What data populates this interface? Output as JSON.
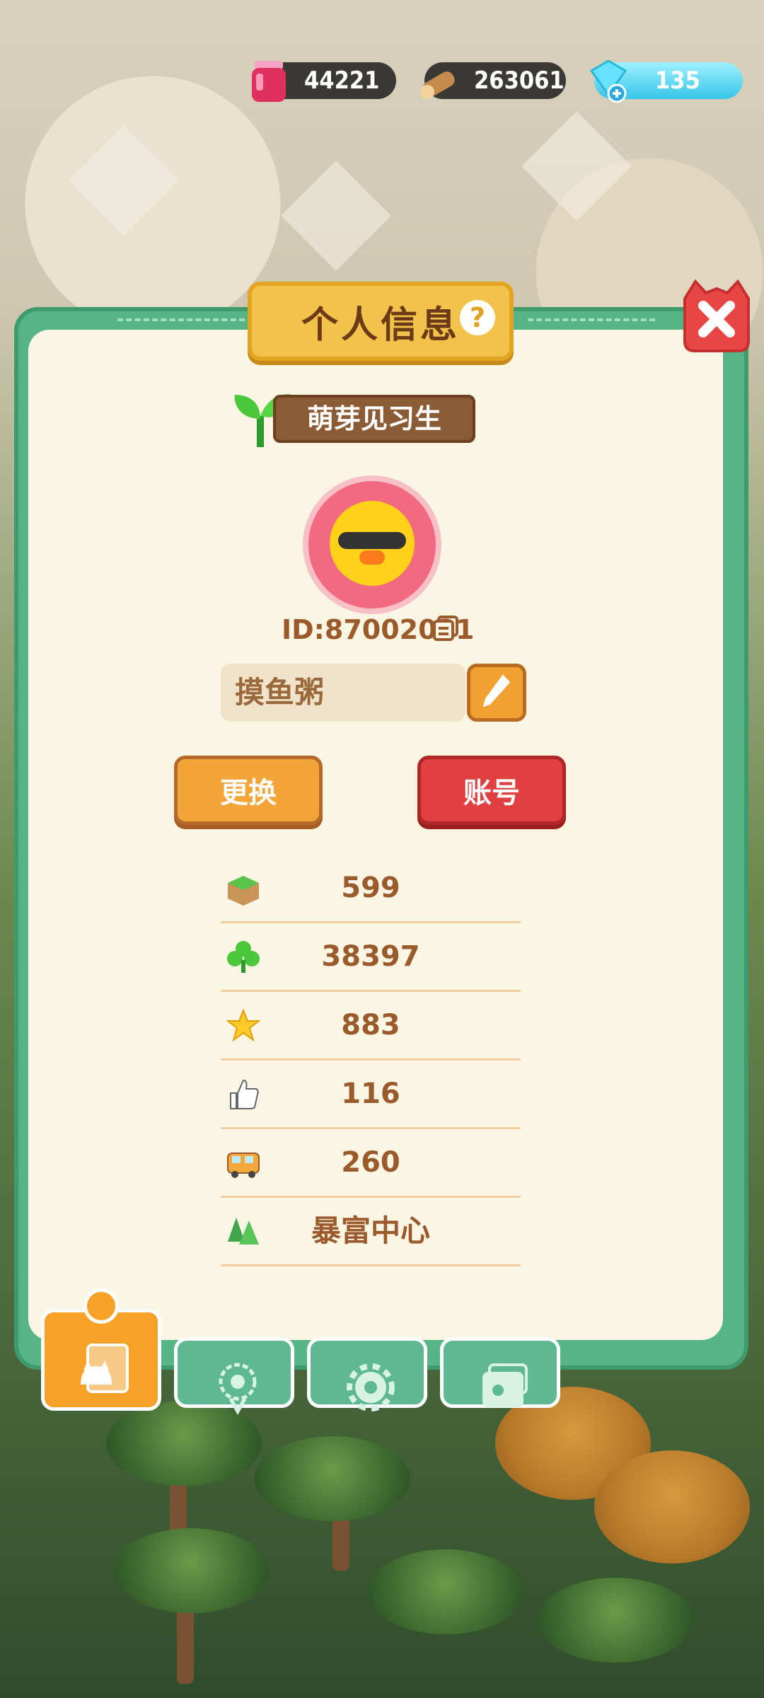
{
  "top_bar": {
    "jam": "44221",
    "wood": "263061",
    "gems": "135"
  },
  "panel": {
    "title": "个人信息",
    "help_symbol": "?",
    "rank_title": "萌芽见习生",
    "user_id": "ID:87002031",
    "nickname": "摸鱼粥",
    "buttons": {
      "change": "更换",
      "account": "账号"
    },
    "stats": [
      {
        "icon": "grass-block-icon",
        "value": "599"
      },
      {
        "icon": "clover-icon",
        "value": "38397"
      },
      {
        "icon": "star-icon",
        "value": "883"
      },
      {
        "icon": "thumbs-up-icon",
        "value": "116"
      },
      {
        "icon": "bus-icon",
        "value": "260"
      },
      {
        "icon": "pine-trees-icon",
        "value": "暴富中心"
      }
    ]
  },
  "colors": {
    "panel_green": "#55b587",
    "panel_cream": "#fbf5e3",
    "title_gold": "#f2c24a",
    "text_brown": "#9a5a2b",
    "button_orange": "#f3a53a",
    "button_red": "#e04040"
  }
}
